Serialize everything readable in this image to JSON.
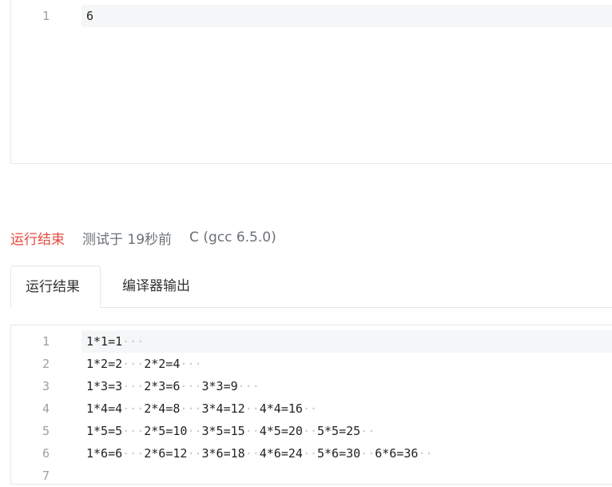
{
  "input_editor": {
    "lines": [
      {
        "num": "1",
        "text": "6"
      }
    ]
  },
  "status": {
    "state": "运行结束",
    "tested": "测试于 19秒前",
    "language": "C (gcc 6.5.0)",
    "state_color": "#e5483f"
  },
  "tabs": [
    {
      "label": "运行结果",
      "active": true
    },
    {
      "label": "编译器输出",
      "active": false
    }
  ],
  "output_editor": {
    "lines": [
      {
        "num": "1",
        "text": "1*1=1···"
      },
      {
        "num": "2",
        "text": "1*2=2···2*2=4···"
      },
      {
        "num": "3",
        "text": "1*3=3···2*3=6···3*3=9···"
      },
      {
        "num": "4",
        "text": "1*4=4···2*4=8···3*4=12··4*4=16··"
      },
      {
        "num": "5",
        "text": "1*5=5···2*5=10··3*5=15··4*5=20··5*5=25··"
      },
      {
        "num": "6",
        "text": "1*6=6···2*6=12··3*6=18··4*6=24··5*6=30··6*6=36··"
      },
      {
        "num": "7",
        "text": ""
      }
    ]
  }
}
